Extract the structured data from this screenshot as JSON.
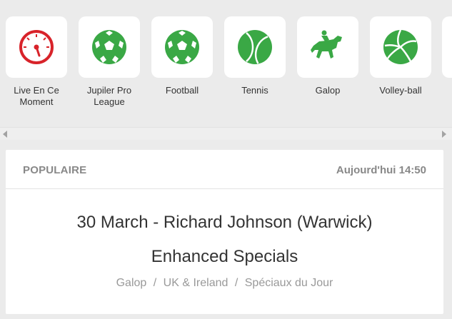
{
  "sports": [
    {
      "label": "Live En Ce Moment",
      "icon": "live-gauge-icon"
    },
    {
      "label": "Jupiler Pro League",
      "icon": "soccer-ball-icon"
    },
    {
      "label": "Football",
      "icon": "soccer-ball-icon"
    },
    {
      "label": "Tennis",
      "icon": "tennis-ball-icon"
    },
    {
      "label": "Galop",
      "icon": "horse-jockey-icon"
    },
    {
      "label": "Volley-ball",
      "icon": "volleyball-icon"
    }
  ],
  "colors": {
    "sport_green": "#3aa845",
    "live_red": "#d8232a",
    "background": "#ebebeb"
  },
  "card": {
    "category": "POPULAIRE",
    "time": "Aujourd'hui 14:50",
    "event_title": "30 March - Richard Johnson (Warwick)",
    "market": "Enhanced Specials",
    "breadcrumb": [
      "Galop",
      "UK & Ireland",
      "Spéciaux du Jour"
    ],
    "separator": "/"
  }
}
